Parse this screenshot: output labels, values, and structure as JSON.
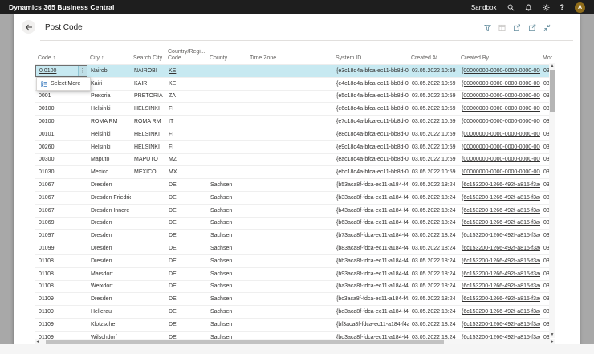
{
  "app": {
    "title": "Dynamics 365 Business Central",
    "environment": "Sandbox",
    "help_label": "?",
    "avatar_initial": "A"
  },
  "page": {
    "title": "Post Code"
  },
  "icons": {
    "row_more": "⋮",
    "vscroll_up": "▲",
    "vscroll_down": "▼",
    "hscroll_left": "◄",
    "hscroll_right": "►"
  },
  "colors": {
    "topbar_bg": "#1e1e1e",
    "selected_row_bg": "#c7e9f1",
    "avatar_bg": "#8f6c1a",
    "toolbar_icon": "#678f9f",
    "select_more_icon": "#3a7bbf"
  },
  "context_menu": {
    "items": [
      {
        "label": "Select More"
      }
    ]
  },
  "table": {
    "columns": [
      {
        "key": "code",
        "label": "Code ↑"
      },
      {
        "key": "city",
        "label": "City ↑"
      },
      {
        "key": "search_city",
        "label": "Search City"
      },
      {
        "key": "country",
        "label": "Country/Regi...\nCode"
      },
      {
        "key": "county",
        "label": "County"
      },
      {
        "key": "time_zone",
        "label": "Time Zone"
      },
      {
        "key": "system_id",
        "label": "System ID"
      },
      {
        "key": "created_at",
        "label": "Created At"
      },
      {
        "key": "created_by",
        "label": "Created By"
      },
      {
        "key": "modified",
        "label": "Modi..."
      }
    ],
    "rows": [
      {
        "selected": true,
        "code": "0.0100",
        "city": "Nairobi",
        "search_city": "NAIROBI",
        "country": "KE",
        "county": "",
        "time_zone": "",
        "system_id": "{e3c18d4a-bfca-ec11-bb8d-00...",
        "created_at": "03.05.2022 10:59",
        "created_by": "{00000000-0000-0000-0000-000...",
        "modified": "03"
      },
      {
        "code": "",
        "city": "Kairi",
        "search_city": "KAIRI",
        "country": "KE",
        "county": "",
        "time_zone": "",
        "system_id": "{e4c18d4a-bfca-ec11-bb8d-00...",
        "created_at": "03.05.2022 10:59",
        "created_by": "{00000000-0000-0000-0000-000...",
        "modified": "03"
      },
      {
        "code": "0001",
        "city": "Pretoria",
        "search_city": "PRETORIA",
        "country": "ZA",
        "county": "",
        "time_zone": "",
        "system_id": "{e5c18d4a-bfca-ec11-bb8d-00...",
        "created_at": "03.05.2022 10:59",
        "created_by": "{00000000-0000-0000-0000-000...",
        "modified": "03"
      },
      {
        "code": "00100",
        "city": "Helsinki",
        "search_city": "HELSINKI",
        "country": "FI",
        "county": "",
        "time_zone": "",
        "system_id": "{e6c18d4a-bfca-ec11-bb8d-00...",
        "created_at": "03.05.2022 10:59",
        "created_by": "{00000000-0000-0000-0000-000...",
        "modified": "03"
      },
      {
        "code": "00100",
        "city": "ROMA RM",
        "search_city": "ROMA RM",
        "country": "IT",
        "county": "",
        "time_zone": "",
        "system_id": "{e7c18d4a-bfca-ec11-bb8d-00...",
        "created_at": "03.05.2022 10:59",
        "created_by": "{00000000-0000-0000-0000-000...",
        "modified": "03"
      },
      {
        "code": "00101",
        "city": "Helsinki",
        "search_city": "HELSINKI",
        "country": "FI",
        "county": "",
        "time_zone": "",
        "system_id": "{e8c18d4a-bfca-ec11-bb8d-00...",
        "created_at": "03.05.2022 10:59",
        "created_by": "{00000000-0000-0000-0000-000...",
        "modified": "03"
      },
      {
        "code": "00260",
        "city": "Helsinki",
        "search_city": "HELSINKI",
        "country": "FI",
        "county": "",
        "time_zone": "",
        "system_id": "{e9c18d4a-bfca-ec11-bb8d-00...",
        "created_at": "03.05.2022 10:59",
        "created_by": "{00000000-0000-0000-0000-000...",
        "modified": "03"
      },
      {
        "code": "00300",
        "city": "Maputo",
        "search_city": "MAPUTO",
        "country": "MZ",
        "county": "",
        "time_zone": "",
        "system_id": "{eac18d4a-bfca-ec11-bb8d-00...",
        "created_at": "03.05.2022 10:59",
        "created_by": "{00000000-0000-0000-0000-000...",
        "modified": "03"
      },
      {
        "code": "01030",
        "city": "Mexico",
        "search_city": "MEXICO",
        "country": "MX",
        "county": "",
        "time_zone": "",
        "system_id": "{ebc18d4a-bfca-ec11-bb8d-00...",
        "created_at": "03.05.2022 10:59",
        "created_by": "{00000000-0000-0000-0000-000...",
        "modified": "03"
      },
      {
        "code": "01067",
        "city": "Dresden",
        "search_city": "",
        "country": "DE",
        "county": "Sachsen",
        "time_zone": "",
        "system_id": "{b53aca8f-fdca-ec11-a184-f4a...",
        "created_at": "03.05.2022 18:24",
        "created_by": "{6c153200-1266-492f-a815-f3ae...",
        "modified": "03"
      },
      {
        "code": "01067",
        "city": "Dresden Friedric...",
        "search_city": "",
        "country": "DE",
        "county": "Sachsen",
        "time_zone": "",
        "system_id": "{b33aca8f-fdca-ec11-a184-f4a...",
        "created_at": "03.05.2022 18:24",
        "created_by": "{6c153200-1266-492f-a815-f3ae...",
        "modified": "03"
      },
      {
        "code": "01067",
        "city": "Dresden Innere ...",
        "search_city": "",
        "country": "DE",
        "county": "Sachsen",
        "time_zone": "",
        "system_id": "{b43aca8f-fdca-ec11-a184-f4a...",
        "created_at": "03.05.2022 18:24",
        "created_by": "{6c153200-1266-492f-a815-f3ae...",
        "modified": "03"
      },
      {
        "code": "01069",
        "city": "Dresden",
        "search_city": "",
        "country": "DE",
        "county": "Sachsen",
        "time_zone": "",
        "system_id": "{b63aca8f-fdca-ec11-a184-f4a...",
        "created_at": "03.05.2022 18:24",
        "created_by": "{6c153200-1266-492f-a815-f3ae...",
        "modified": "03"
      },
      {
        "code": "01097",
        "city": "Dresden",
        "search_city": "",
        "country": "DE",
        "county": "Sachsen",
        "time_zone": "",
        "system_id": "{b73aca8f-fdca-ec11-a184-f4a...",
        "created_at": "03.05.2022 18:24",
        "created_by": "{6c153200-1266-492f-a815-f3ae...",
        "modified": "03"
      },
      {
        "code": "01099",
        "city": "Dresden",
        "search_city": "",
        "country": "DE",
        "county": "Sachsen",
        "time_zone": "",
        "system_id": "{b83aca8f-fdca-ec11-a184-f4a...",
        "created_at": "03.05.2022 18:24",
        "created_by": "{6c153200-1266-492f-a815-f3ae...",
        "modified": "03"
      },
      {
        "code": "01108",
        "city": "Dresden",
        "search_city": "",
        "country": "DE",
        "county": "Sachsen",
        "time_zone": "",
        "system_id": "{bb3aca8f-fdca-ec11-a184-f4a...",
        "created_at": "03.05.2022 18:24",
        "created_by": "{6c153200-1266-492f-a815-f3ae...",
        "modified": "03"
      },
      {
        "code": "01108",
        "city": "Marsdorf",
        "search_city": "",
        "country": "DE",
        "county": "Sachsen",
        "time_zone": "",
        "system_id": "{b93aca8f-fdca-ec11-a184-f4a...",
        "created_at": "03.05.2022 18:24",
        "created_by": "{6c153200-1266-492f-a815-f3ae...",
        "modified": "03"
      },
      {
        "code": "01108",
        "city": "Weixdorf",
        "search_city": "",
        "country": "DE",
        "county": "Sachsen",
        "time_zone": "",
        "system_id": "{ba3aca8f-fdca-ec11-a184-f4ac...",
        "created_at": "03.05.2022 18:24",
        "created_by": "{6c153200-1266-492f-a815-f3ae...",
        "modified": "03"
      },
      {
        "code": "01109",
        "city": "Dresden",
        "search_city": "",
        "country": "DE",
        "county": "Sachsen",
        "time_zone": "",
        "system_id": "{bc3aca8f-fdca-ec11-a184-f4ac...",
        "created_at": "03.05.2022 18:24",
        "created_by": "{6c153200-1266-492f-a815-f3ae...",
        "modified": "03"
      },
      {
        "code": "01109",
        "city": "Hellerau",
        "search_city": "",
        "country": "DE",
        "county": "Sachsen",
        "time_zone": "",
        "system_id": "{be3aca8f-fdca-ec11-a184-f4a...",
        "created_at": "03.05.2022 18:24",
        "created_by": "{6c153200-1266-492f-a815-f3ae...",
        "modified": "03"
      },
      {
        "code": "01109",
        "city": "Klotzsche",
        "search_city": "",
        "country": "DE",
        "county": "Sachsen",
        "time_zone": "",
        "system_id": "{bf3aca8f-fdca-ec11-a184-f4ac...",
        "created_at": "03.05.2022 18:24",
        "created_by": "{6c153200-1266-492f-a815-f3ae...",
        "modified": "03"
      },
      {
        "code": "01109",
        "city": "Wilschdorf",
        "search_city": "",
        "country": "DE",
        "county": "Sachsen",
        "time_zone": "",
        "system_id": "{bd3aca8f-fdca-ec11-a184-f4a...",
        "created_at": "03.05.2022 18:24",
        "created_by": "{6c153200-1266-492f-a815-f3ae...",
        "modified": "03"
      }
    ]
  }
}
